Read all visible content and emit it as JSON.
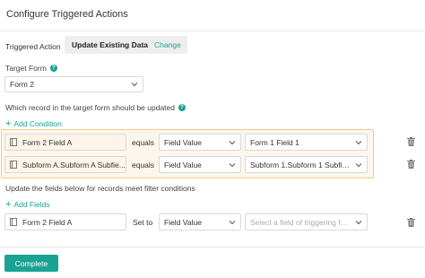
{
  "title": "Configure Triggered Actions",
  "triggered_action": {
    "label": "Triggered Action",
    "value": "Update Existing Data",
    "change_label": "Change"
  },
  "target_form": {
    "label": "Target Form",
    "value": "Form 2"
  },
  "filter_section": {
    "label": "Which record in the target form should be updated",
    "add_label": "Add Condition",
    "conditions": [
      {
        "field": "Form 2 Field A",
        "operator": "equals",
        "value_type": "Field Value",
        "value": "Form 1 Field 1"
      },
      {
        "field": "Subform A.Subform A Subfie...",
        "operator": "equals",
        "value_type": "Field Value",
        "value": "Subform 1.Subform 1 Subfield"
      }
    ]
  },
  "update_section": {
    "label": "Update the fields below for records meet filter conditions",
    "add_label": "Add Fields",
    "fields": [
      {
        "field": "Form 2 Field A",
        "operator": "Set to",
        "value_type": "Field Value",
        "value_placeholder": "Select a field of triggering fo..."
      }
    ]
  },
  "complete_label": "Complete",
  "icons": {
    "help": "question-circle-icon",
    "field": "document-icon",
    "dropdown": "chevron-down-icon",
    "delete": "trash-icon",
    "add": "plus-icon"
  },
  "colors": {
    "accent": "#1aa394",
    "highlight_border": "#f3c98b",
    "highlight_bg": "#fdf6ec"
  }
}
